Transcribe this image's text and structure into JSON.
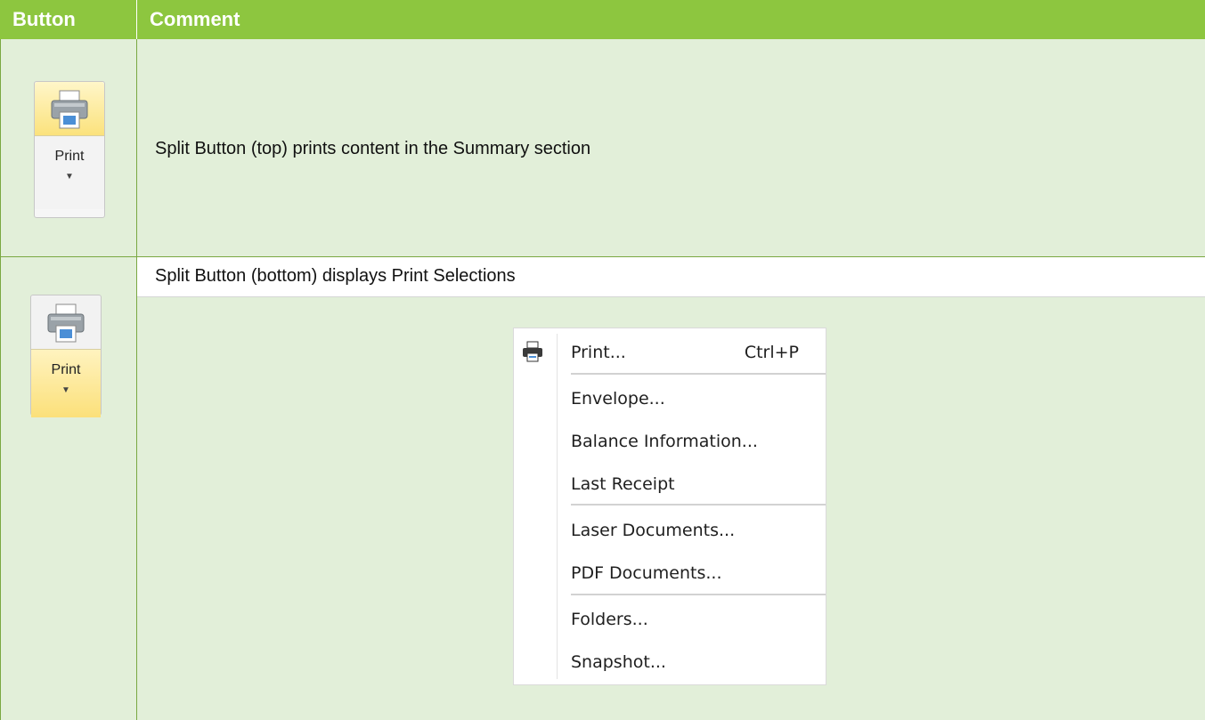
{
  "table": {
    "header_button": "Button",
    "header_comment": "Comment"
  },
  "row1": {
    "button_label": "Print",
    "comment": "Split Button (top) prints content in the Summary section"
  },
  "row2": {
    "button_label": "Print",
    "comment": "Split Button (bottom) displays Print Selections"
  },
  "menu": {
    "items": [
      {
        "label": "Print...",
        "shortcut": "Ctrl+P",
        "icon": "printer-icon"
      },
      {
        "label": "Envelope..."
      },
      {
        "label": "Balance Information..."
      },
      {
        "label": "Last Receipt"
      },
      {
        "label": "Laser Documents..."
      },
      {
        "label": "PDF Documents..."
      },
      {
        "label": "Folders..."
      },
      {
        "label": "Snapshot..."
      }
    ]
  },
  "colors": {
    "header_bg": "#8dc63f",
    "cell_bg": "#e2efd9",
    "highlight": "#fbe27c"
  }
}
